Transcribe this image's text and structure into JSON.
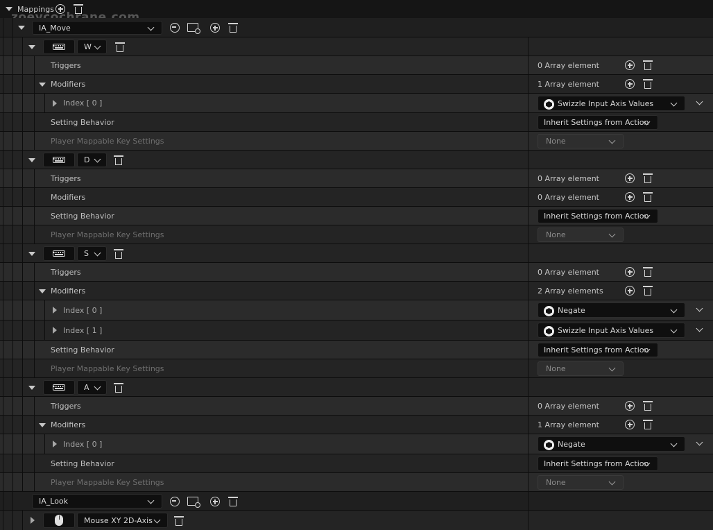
{
  "header": {
    "label": "Mappings"
  },
  "watermark": "zoevcochrane.com",
  "actions": [
    {
      "name": "IA_Move"
    },
    {
      "name": "IA_Look"
    }
  ],
  "keys": [
    {
      "key": "W"
    },
    {
      "key": "D"
    },
    {
      "key": "S"
    },
    {
      "key": "A"
    },
    {
      "key": "Mouse XY 2D-Axis"
    }
  ],
  "labels": {
    "triggers": "Triggers",
    "modifiers": "Modifiers",
    "setting_behavior": "Setting Behavior",
    "player_mappable": "Player Mappable Key Settings",
    "index_0": "Index [ 0 ]",
    "index_1": "Index [ 1 ]"
  },
  "values": {
    "zero_elements": "0 Array element",
    "one_element": "1 Array element",
    "two_elements": "2 Array elements",
    "inherit": "Inherit Settings from Action",
    "none": "None",
    "swizzle": "Swizzle Input Axis Values",
    "negate": "Negate"
  },
  "colors": {
    "bg_dark": "#151515",
    "row_a": "#242424",
    "row_b": "#2b2b2b",
    "dropdown_bg": "#0f0f0f",
    "text": "#c0c0c0",
    "disabled_text": "#6f6f6f"
  }
}
